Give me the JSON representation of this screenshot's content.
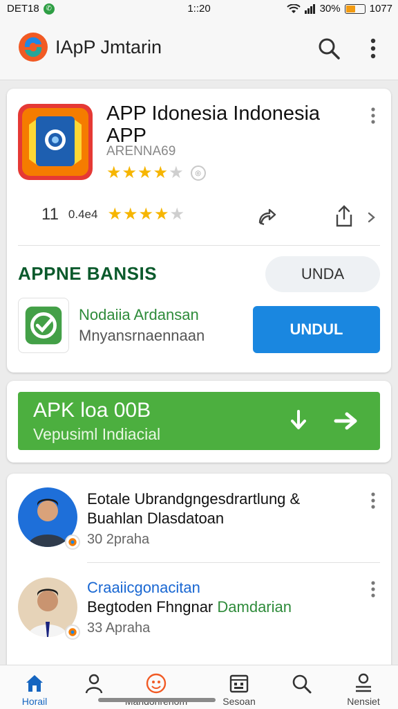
{
  "status_bar": {
    "carrier": "DET18",
    "notif_badge": "✆",
    "time": "1::20",
    "battery_percent": "30%",
    "extra": "1077",
    "battery_level": 0.5,
    "battery_color": "#f29b12"
  },
  "app_bar": {
    "title": "IApP Jmtarin",
    "logo_icon": "app-logo",
    "search_icon": "search-icon",
    "more_icon": "more-vert-icon"
  },
  "app_card": {
    "name": "APP Idonesia Indonesia APP",
    "developer": "ARENNA69",
    "rating_stars": 4,
    "max_stars": 5,
    "meta_count": "11",
    "meta_small": "0.4e4",
    "meta_stars": 4,
    "section_title": "APPNE BANSIS",
    "pill_label": "UNDA",
    "promo_title": "Nodaiia Ardansan",
    "promo_subtitle": "Mnyansrnaennaan",
    "install_label": "UNDUL"
  },
  "apk_banner": {
    "title": "APK loa 00B",
    "subtitle": "Vepusiml Indiacial",
    "color": "#4caf3f"
  },
  "feed": [
    {
      "line1": "Eotale Ubrandgngesdrartlung &",
      "line2": "Buahlan Dlasdatoan",
      "meta": "30 2praha"
    },
    {
      "line1": "Craaiicgonacitan",
      "line2_a": "Begtoden Fhngnar",
      "line2_b": "Damdarian",
      "meta": "33 Apraha"
    }
  ],
  "bottom_nav": [
    {
      "label": "Horail",
      "icon": "home-icon"
    },
    {
      "label": "",
      "icon": "profile-icon"
    },
    {
      "label": "Marldohrenom",
      "icon": "emoji-icon"
    },
    {
      "label": "Sesoan",
      "icon": "calendar-icon"
    },
    {
      "label": "",
      "icon": "search-icon"
    },
    {
      "label": "Nensiet",
      "icon": "account-icon"
    }
  ],
  "colors": {
    "accent_blue": "#1a87e0",
    "accent_green": "#4caf3f",
    "section_green": "#0b5a2c",
    "star": "#f6b500"
  }
}
